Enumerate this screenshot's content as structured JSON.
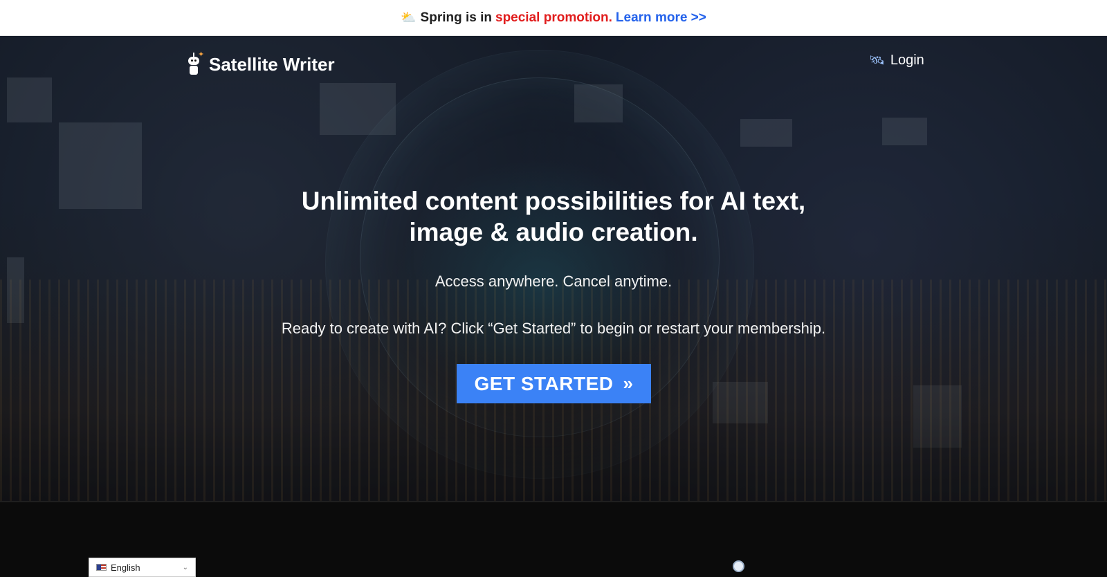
{
  "promo": {
    "icon": "sun-behind-cloud-icon",
    "text": "Spring is in",
    "highlight": "special promotion.",
    "link_label": "Learn more >>",
    "colors": {
      "text": "#1f1f1f",
      "highlight": "#e11d1d",
      "link": "#2563eb"
    }
  },
  "header": {
    "brand_name": "Satellite Writer",
    "brand_icon": "robot-icon",
    "login_label": "Login",
    "login_icon": "satellite-icon"
  },
  "hero": {
    "headline_line1": "Unlimited content possibilities for AI text,",
    "headline_line2": "image & audio creation.",
    "subline": "Access anywhere. Cancel anytime.",
    "ready_line": "Ready to create with AI? Click “Get Started” to begin or restart your membership.",
    "cta_label": "GET STARTED",
    "cta_icon": "chevrons-right-icon",
    "cta_color": "#3b82f6"
  },
  "footer": {
    "language": "English",
    "language_flag": "us-flag-icon"
  }
}
